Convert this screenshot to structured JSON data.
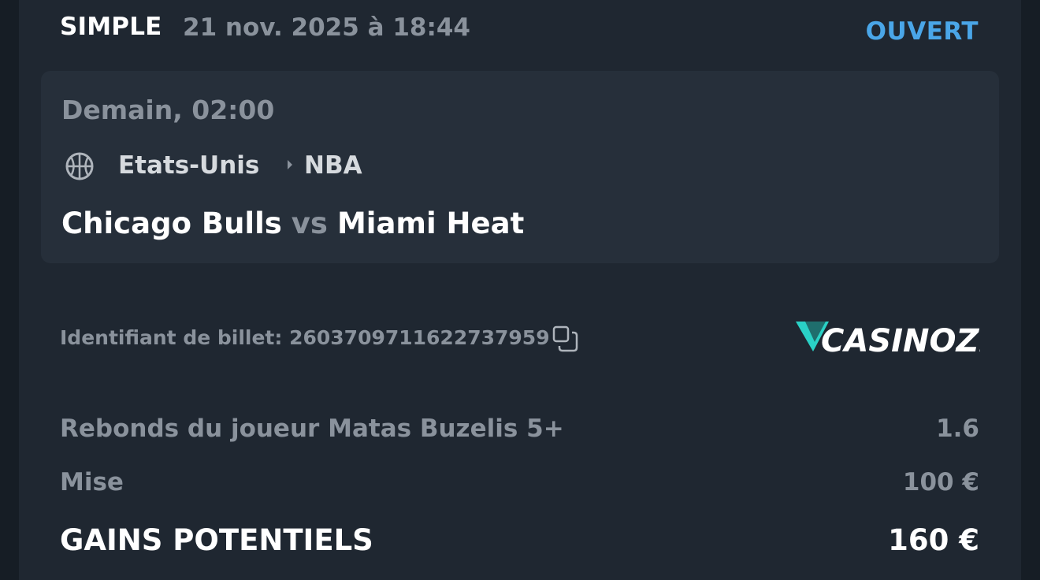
{
  "header": {
    "bet_type": "SIMPLE",
    "placed_at": "21 nov. 2025 à 18:44",
    "status": "OUVERT",
    "status_color": "#4aa6e8"
  },
  "event": {
    "time": "Demain, 02:00",
    "sport_icon": "basketball-icon",
    "country": "Etats-Unis",
    "league": "NBA",
    "home_team": "Chicago Bulls",
    "vs": "vs",
    "away_team": "Miami Heat"
  },
  "ticket": {
    "id_label": "Identifiant de billet: 2603709711622737959",
    "copy_icon": "copy-icon",
    "brand": "CASINOZER"
  },
  "selection": {
    "label": "Rebonds du joueur Matas Buzelis 5+",
    "odds": "1.6"
  },
  "stake": {
    "label": "Mise",
    "value": "100 €"
  },
  "potential_win": {
    "label": "GAINS POTENTIELS",
    "value": "160 €"
  }
}
